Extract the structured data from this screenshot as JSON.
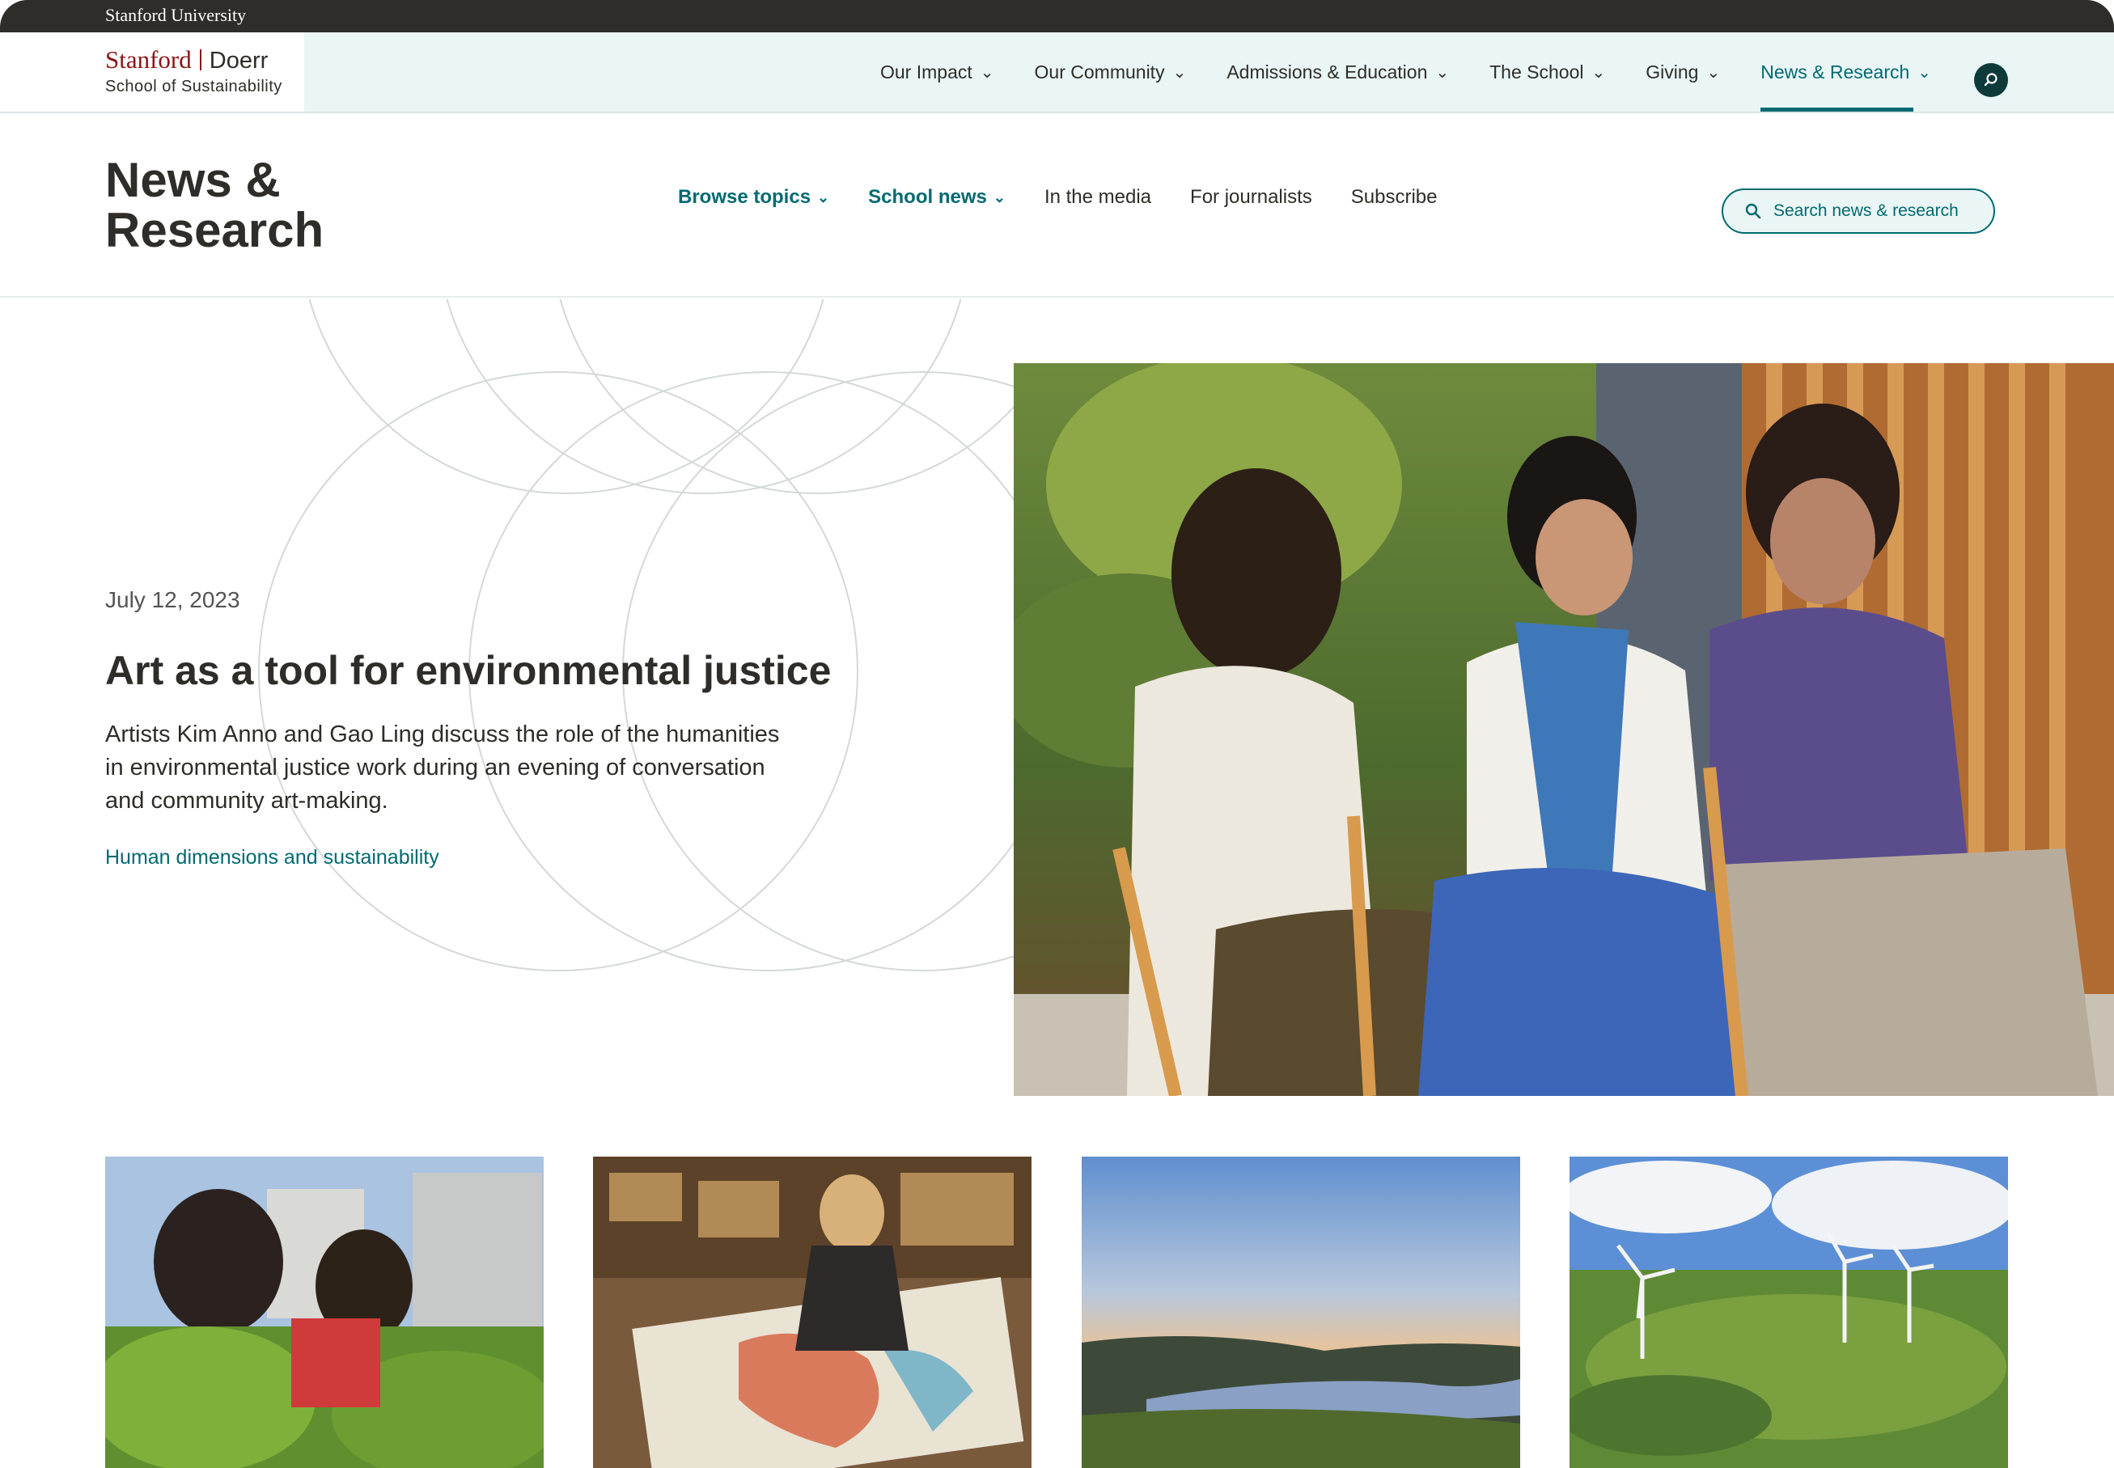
{
  "top_bar": {
    "brand": "Stanford University"
  },
  "logo": {
    "stanford": "Stanford",
    "doerr": "Doerr",
    "school": "School of Sustainability"
  },
  "main_nav": [
    {
      "label": "Our Impact"
    },
    {
      "label": "Our Community"
    },
    {
      "label": "Admissions & Education"
    },
    {
      "label": "The School"
    },
    {
      "label": "Giving"
    },
    {
      "label": "News & Research",
      "active": true
    }
  ],
  "section": {
    "title": "News &\nResearch",
    "sub_nav": [
      {
        "label": "Browse topics",
        "dropdown": true
      },
      {
        "label": "School news",
        "dropdown": true
      },
      {
        "label": "In the media"
      },
      {
        "label": "For journalists"
      },
      {
        "label": "Subscribe"
      }
    ],
    "search_placeholder": "Search news & research"
  },
  "hero": {
    "date": "July 12, 2023",
    "title": "Art as a tool for environmental justice",
    "description": "Artists Kim Anno and Gao Ling discuss the role of the humanities in environmental justice work during an evening of conversation and community art-making.",
    "topic": "Human dimensions and sustainability"
  },
  "icons": {
    "chevron": "chevron-down-icon",
    "search": "search-icon"
  },
  "colors": {
    "teal": "#016a71",
    "cardinal": "#8c1515",
    "dark": "#2e2d29",
    "header_bg": "#eaf5f5"
  }
}
